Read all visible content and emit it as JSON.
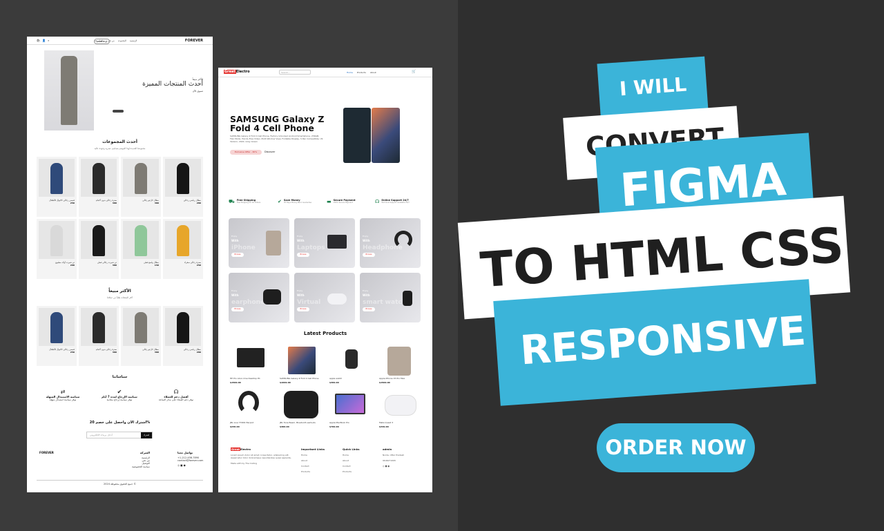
{
  "banner": {
    "line1": "I WILL",
    "line2": "CONVERT",
    "line3": "FIGMA",
    "line4": "TO HTML CSS",
    "line5": "RESPONSIVE",
    "cta": "ORDER NOW"
  },
  "colors": {
    "accent_blue": "#3bb4d9",
    "background_dark": "#333333",
    "brand_red": "#e53935"
  },
  "fashion": {
    "logo": "FOREVER",
    "nav": [
      "الرئيسية",
      "المجموعة",
      "من نحن",
      "تواصل معنا"
    ],
    "login": "لوحة التحكم",
    "hero_kicker": "الأكثر مبيعاً",
    "hero_title": "أحدث المنتجات المميزة",
    "hero_link": "تسوق الآن",
    "section1_title": "أحدث المجموعات",
    "section1_sub": "مجموعتنا الجديدة لهذا الموسم بتصاميم عصرية وجودة عالية",
    "section2_title": "الأكثر مبيعاً",
    "section2_sub": "أكثر المنتجات طلباً من عملائنا",
    "products": [
      {
        "name": "قميص رجالي كاجوال للأطفال",
        "price": "250"
      },
      {
        "name": "سترة رجالي بدون أكمام",
        "price": "380"
      },
      {
        "name": "بنطال كارغو رجالي",
        "price": "380"
      },
      {
        "name": "بنطال رياضي رجالي",
        "price": "280"
      },
      {
        "name": "تي شيرت أولاد مطبوع",
        "price": "290"
      },
      {
        "name": "تي شيرت رجالي قطن",
        "price": "380"
      },
      {
        "name": "بنطال واسع قطن",
        "price": "150"
      },
      {
        "name": "سترة رجالي صفراء",
        "price": "250"
      }
    ],
    "bestsellers": [
      {
        "name": "قميص رجالي كاجوال للأطفال",
        "price": "250"
      },
      {
        "name": "سترة رجالي بدون أكمام",
        "price": "380"
      },
      {
        "name": "بنطال كارغو رجالي",
        "price": "380"
      },
      {
        "name": "بنطال رياضي رجالي",
        "price": "280"
      }
    ],
    "policies_title": "سياساتنا",
    "features": [
      {
        "title": "سياسة الاستبدال السهلة",
        "sub": "نوفر سياسة استبدال سهلة"
      },
      {
        "title": "سياسة الإرجاع لمدة 7 أيام",
        "sub": "نوفر سياسة إرجاع مجانية"
      },
      {
        "title": "أفضل دعم للعملاء",
        "sub": "نوفر دعم العملاء على مدار الساعة"
      }
    ],
    "subscribe_title": "اشترك الآن واحصل على خصم 20%",
    "subscribe_placeholder": "أدخل بريدك الإلكتروني",
    "subscribe_btn": "اشترك",
    "footer": {
      "logo": "FOREVER",
      "col1_title": "الشركة",
      "col1_items": [
        "الرئيسية",
        "من نحن",
        "التوصيل",
        "سياسة الخصوصية"
      ],
      "col2_title": "تواصل معنا",
      "col2_items": [
        "+1-212-456-7890",
        "contact@forever.com"
      ],
      "copyright": "جميع الحقوق محفوظة 2024 ©"
    }
  },
  "electro": {
    "logo_red": "Great",
    "logo_rest": "Electro",
    "search_placeholder": "Search...",
    "nav": [
      "Home",
      "Products",
      "About"
    ],
    "hero_title": "SAMSUNG Galaxy Z Fold 4 Cell Phone",
    "hero_desc": "SAMSUNG Galaxy Z Fold 4 Cell Phone, Factory Unlocked Android Smartphone, 256GB, Flex Mode, Hands-Free Video, Multi Window View, Foldable Display, S Pen Compatible, US Version, 2022, Gray Green",
    "hero_pill": "Exclusive Offer - 30%",
    "hero_link": "Discover",
    "services": [
      {
        "title": "Free Shipping",
        "sub": "Free Shipping for All Orders"
      },
      {
        "title": "Save Money",
        "sub": "30 Days Money Back Guarantee"
      },
      {
        "title": "Secure Payment",
        "sub": "100% Secure Payment"
      },
      {
        "title": "Online Support 24/7",
        "sub": "Technical Support Available 24/7"
      }
    ],
    "categories": [
      {
        "enjoy": "Enjoy",
        "with": "With",
        "name": "iPhone",
        "btn": "Browse"
      },
      {
        "enjoy": "Enjoy",
        "with": "With",
        "name": "Laptops",
        "btn": "Browse"
      },
      {
        "enjoy": "Enjoy",
        "with": "With",
        "name": "Headphone",
        "btn": "Browse"
      },
      {
        "enjoy": "Enjoy",
        "with": "With",
        "name": "earphone",
        "btn": "Browse"
      },
      {
        "enjoy": "Enjoy",
        "with": "With",
        "name": "Virtual",
        "btn": "Browse"
      },
      {
        "enjoy": "Enjoy",
        "with": "With",
        "name": "smart watch",
        "btn": "Browse"
      }
    ],
    "latest_title": "Latest Products",
    "products": [
      {
        "name": "HP Pro All-in-One Desktop PC",
        "price": "$1500.00"
      },
      {
        "name": "SAMSUNG Galaxy Z Fold 4 Cell Phone",
        "price": "$1999.00"
      },
      {
        "name": "apple watch",
        "price": "$399.00"
      },
      {
        "name": "Apple iPhone 15 Pro Max",
        "price": "$1500.00"
      },
      {
        "name": "JBL Live 770NC Earpod",
        "price": "$230.00"
      },
      {
        "name": "JBL Tune Beam, Bluetooth earbuds",
        "price": "$300.00"
      },
      {
        "name": "Apple MacBook Pro",
        "price": "$799.00"
      },
      {
        "name": "Meta Quest 3",
        "price": "$349.00"
      }
    ],
    "footer": {
      "about": "Lorem ipsum dolor sit amet consectetur, adipisicing elit. Aspernatur dolor doloremque repudiandae quasi sapiente.",
      "made_by": "Made with by The Coding",
      "col1_title": "Important Links",
      "col1_items": [
        "Home",
        "About",
        "Contact",
        "Products"
      ],
      "col2_title": "Quick Links",
      "col2_items": [
        "Home",
        "About",
        "Contact",
        "Products"
      ],
      "col3_title": "admin",
      "col3_items": [
        "Noida, Uttar Pradesh",
        "9646271695"
      ]
    }
  }
}
